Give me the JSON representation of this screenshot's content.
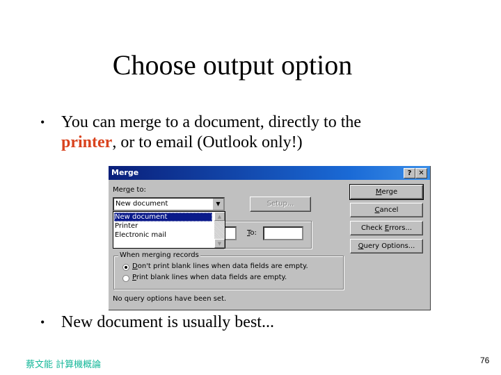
{
  "slide": {
    "title": "Choose output option",
    "bullets": [
      {
        "line1": "You can merge to a document, directly to the",
        "highlight": "printer",
        "line2_rest": ", or to email (Outlook only!)"
      },
      {
        "text": "New document is usually best..."
      }
    ],
    "bullet_glyph": "•",
    "highlight_color": "#d9431e",
    "footer_text": "蔡文能 計算機概論",
    "footer_color": "#17b89a",
    "page_number": "76"
  },
  "dialog": {
    "title": "Merge",
    "help_button": "?",
    "close_button": "✕",
    "merge_to_label_pre": "Mer",
    "merge_to_label_accel": "g",
    "merge_to_label_post": "e to:",
    "merge_to_value": "New document",
    "merge_to_options": [
      "New document",
      "Printer",
      "Electronic mail"
    ],
    "selected_option_index": 0,
    "setup_button": "Setup...",
    "to_label_accel": "T",
    "to_label_post": "o:",
    "to_value": "",
    "from_value": "",
    "buttons": {
      "merge": {
        "accel": "M",
        "rest": "erge"
      },
      "cancel": {
        "accel": "C",
        "rest": "ancel"
      },
      "check_errors": {
        "pre": "Check ",
        "accel": "E",
        "rest": "rrors..."
      },
      "query_options": {
        "accel": "Q",
        "rest": "uery Options..."
      }
    },
    "merging_group_label": "When merging records",
    "radio_options": [
      {
        "accel": "D",
        "rest": "on't print blank lines when data fields are empty.",
        "checked": true
      },
      {
        "accel": "P",
        "rest": "rint blank lines when data fields are empty.",
        "checked": false
      }
    ],
    "status_text": "No query options have been set.",
    "dropdown_arrow": "▼",
    "scroll_up": "▲",
    "scroll_down": "▼"
  }
}
